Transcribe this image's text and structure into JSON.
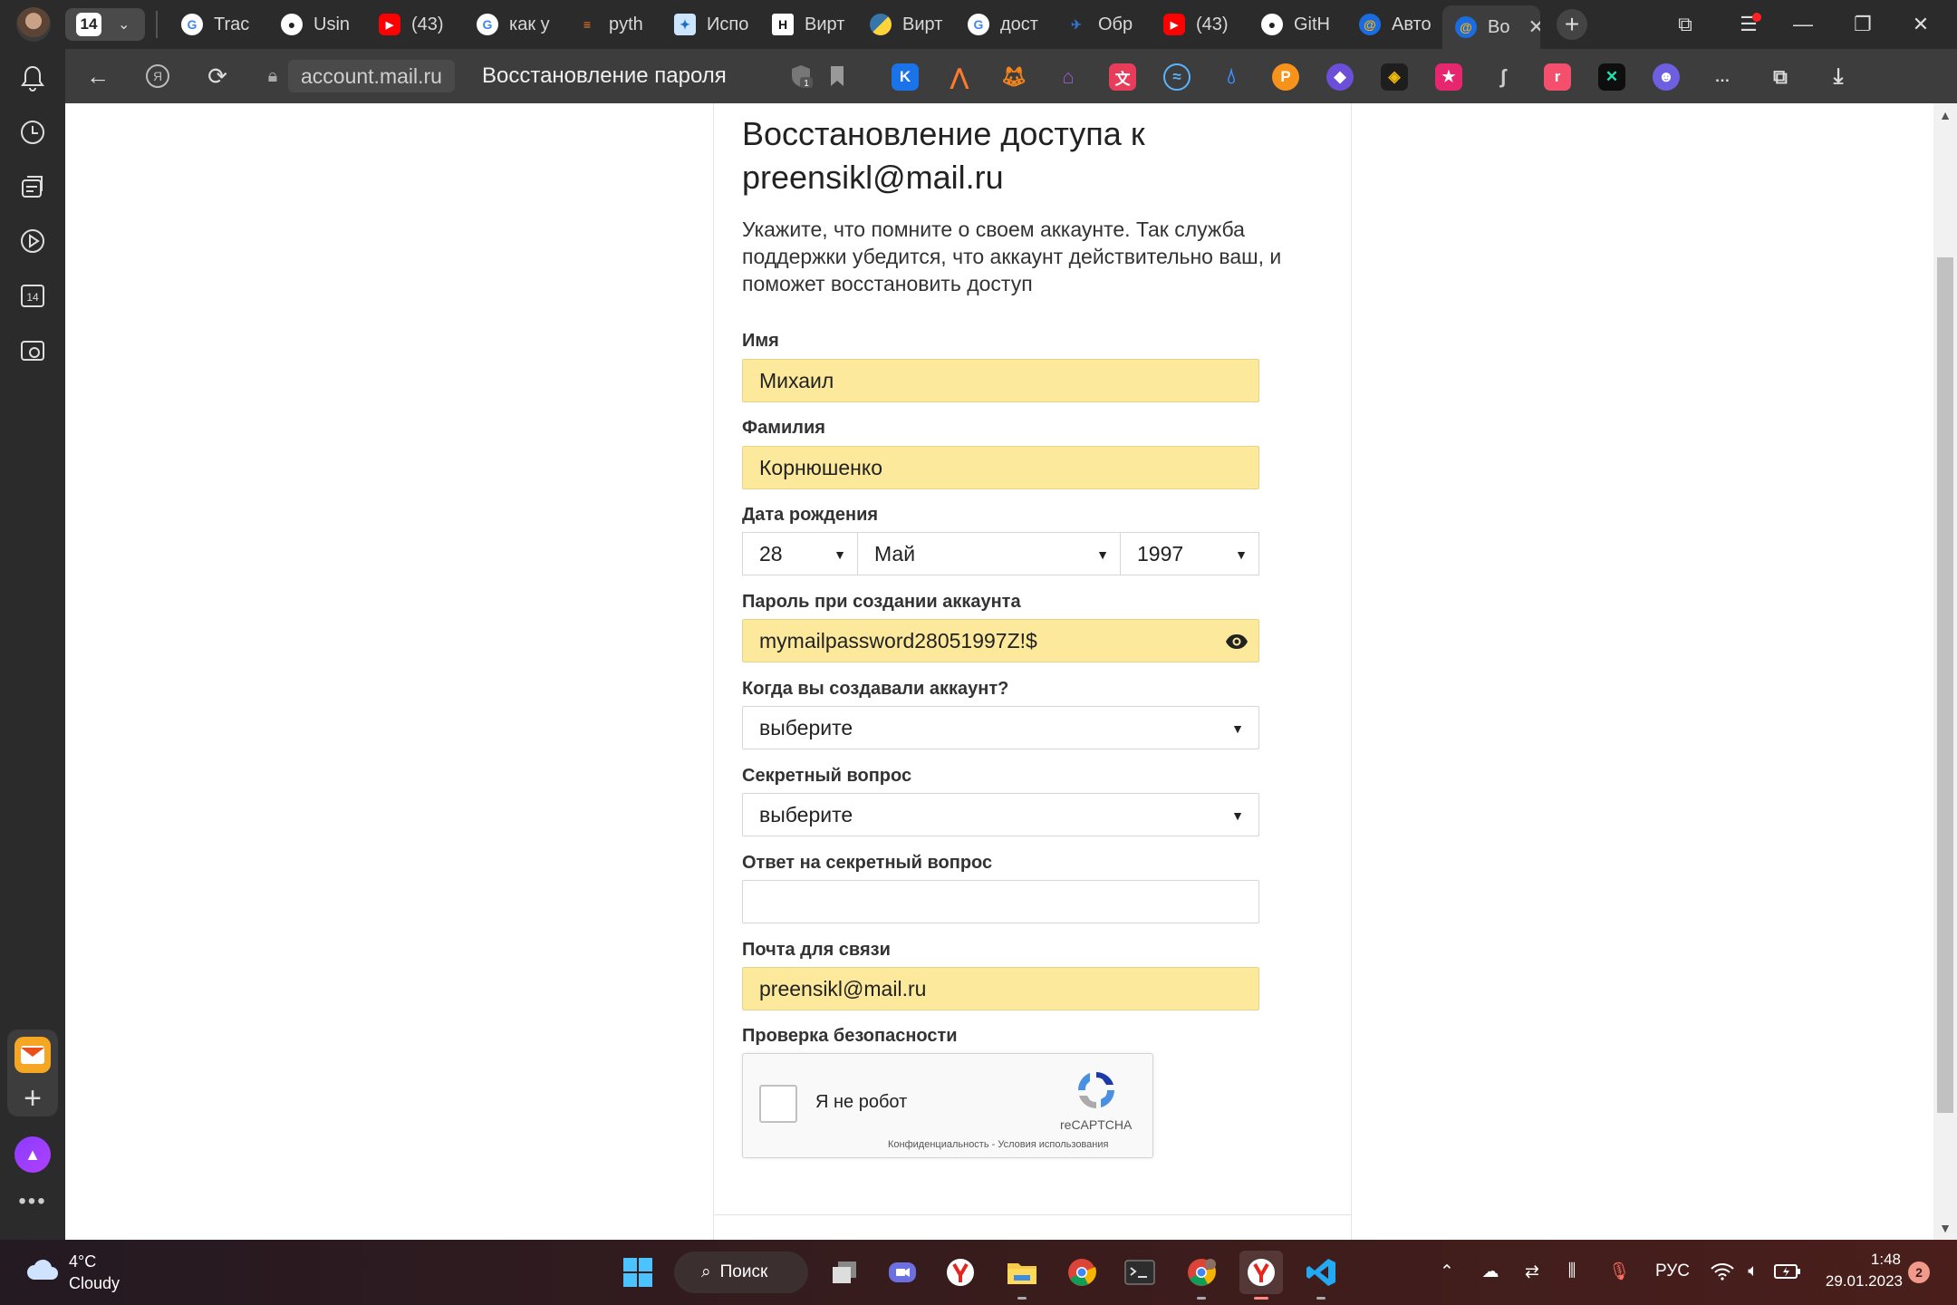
{
  "browser": {
    "tab_count": "14",
    "tabs": [
      {
        "label": "Trac",
        "icon": "google-icon"
      },
      {
        "label": "Usin",
        "icon": "github-icon"
      },
      {
        "label": "(43)",
        "icon": "youtube-icon"
      },
      {
        "label": "как у",
        "icon": "google-icon"
      },
      {
        "label": "pyth",
        "icon": "stackoverflow-icon"
      },
      {
        "label": "Испо",
        "icon": "wand-icon"
      },
      {
        "label": "Вирт",
        "icon": "h-icon"
      },
      {
        "label": "Вирт",
        "icon": "python-icon"
      },
      {
        "label": "дост",
        "icon": "google-icon"
      },
      {
        "label": "Обр",
        "icon": "wing-icon"
      },
      {
        "label": "(43)",
        "icon": "youtube-icon"
      },
      {
        "label": "GitH",
        "icon": "github-icon"
      },
      {
        "label": "Авто",
        "icon": "mailru-icon"
      },
      {
        "label": "Во",
        "icon": "mailru-icon",
        "active": true
      }
    ],
    "url_domain": "account.mail.ru",
    "page_title": "Восстановление пароля",
    "shield_badge": "1"
  },
  "page": {
    "heading": "Восстановление доступа к preensikl@mail.ru",
    "description": "Укажите, что помните о своем аккаунте. Так служба поддержки убедится, что аккаунт действительно ваш, и поможет восстановить доступ",
    "fields": {
      "first_name": {
        "label": "Имя",
        "value": "Михаил"
      },
      "last_name": {
        "label": "Фамилия",
        "value": "Корнюшенко"
      },
      "birth_date": {
        "label": "Дата рождения",
        "day": "28",
        "month": "Май",
        "year": "1997"
      },
      "password": {
        "label": "Пароль при создании аккаунта",
        "value": "mymailpassword28051997Z!$"
      },
      "created_when": {
        "label": "Когда вы создавали аккаунт?",
        "value": "выберите"
      },
      "secret_question": {
        "label": "Секретный вопрос",
        "value": "выберите"
      },
      "secret_answer": {
        "label": "Ответ на секретный вопрос",
        "value": ""
      },
      "contact_email": {
        "label": "Почта для связи",
        "value": "preensikl@mail.ru"
      }
    },
    "security": {
      "label": "Проверка безопасности",
      "captcha_text": "Я не робот",
      "captcha_brand": "reCAPTCHA",
      "captcha_links": "Конфиденциальность - Условия использования"
    }
  },
  "taskbar": {
    "weather_temp": "4°C",
    "weather_condition": "Cloudy",
    "search_label": "Поиск",
    "language": "РУС",
    "time": "1:48",
    "date": "29.01.2023",
    "notifications": "2"
  },
  "colors": {
    "autofill": "#fde99b",
    "browser_bg": "#2b2b2b",
    "toolbar_bg": "#3d3d3d"
  }
}
